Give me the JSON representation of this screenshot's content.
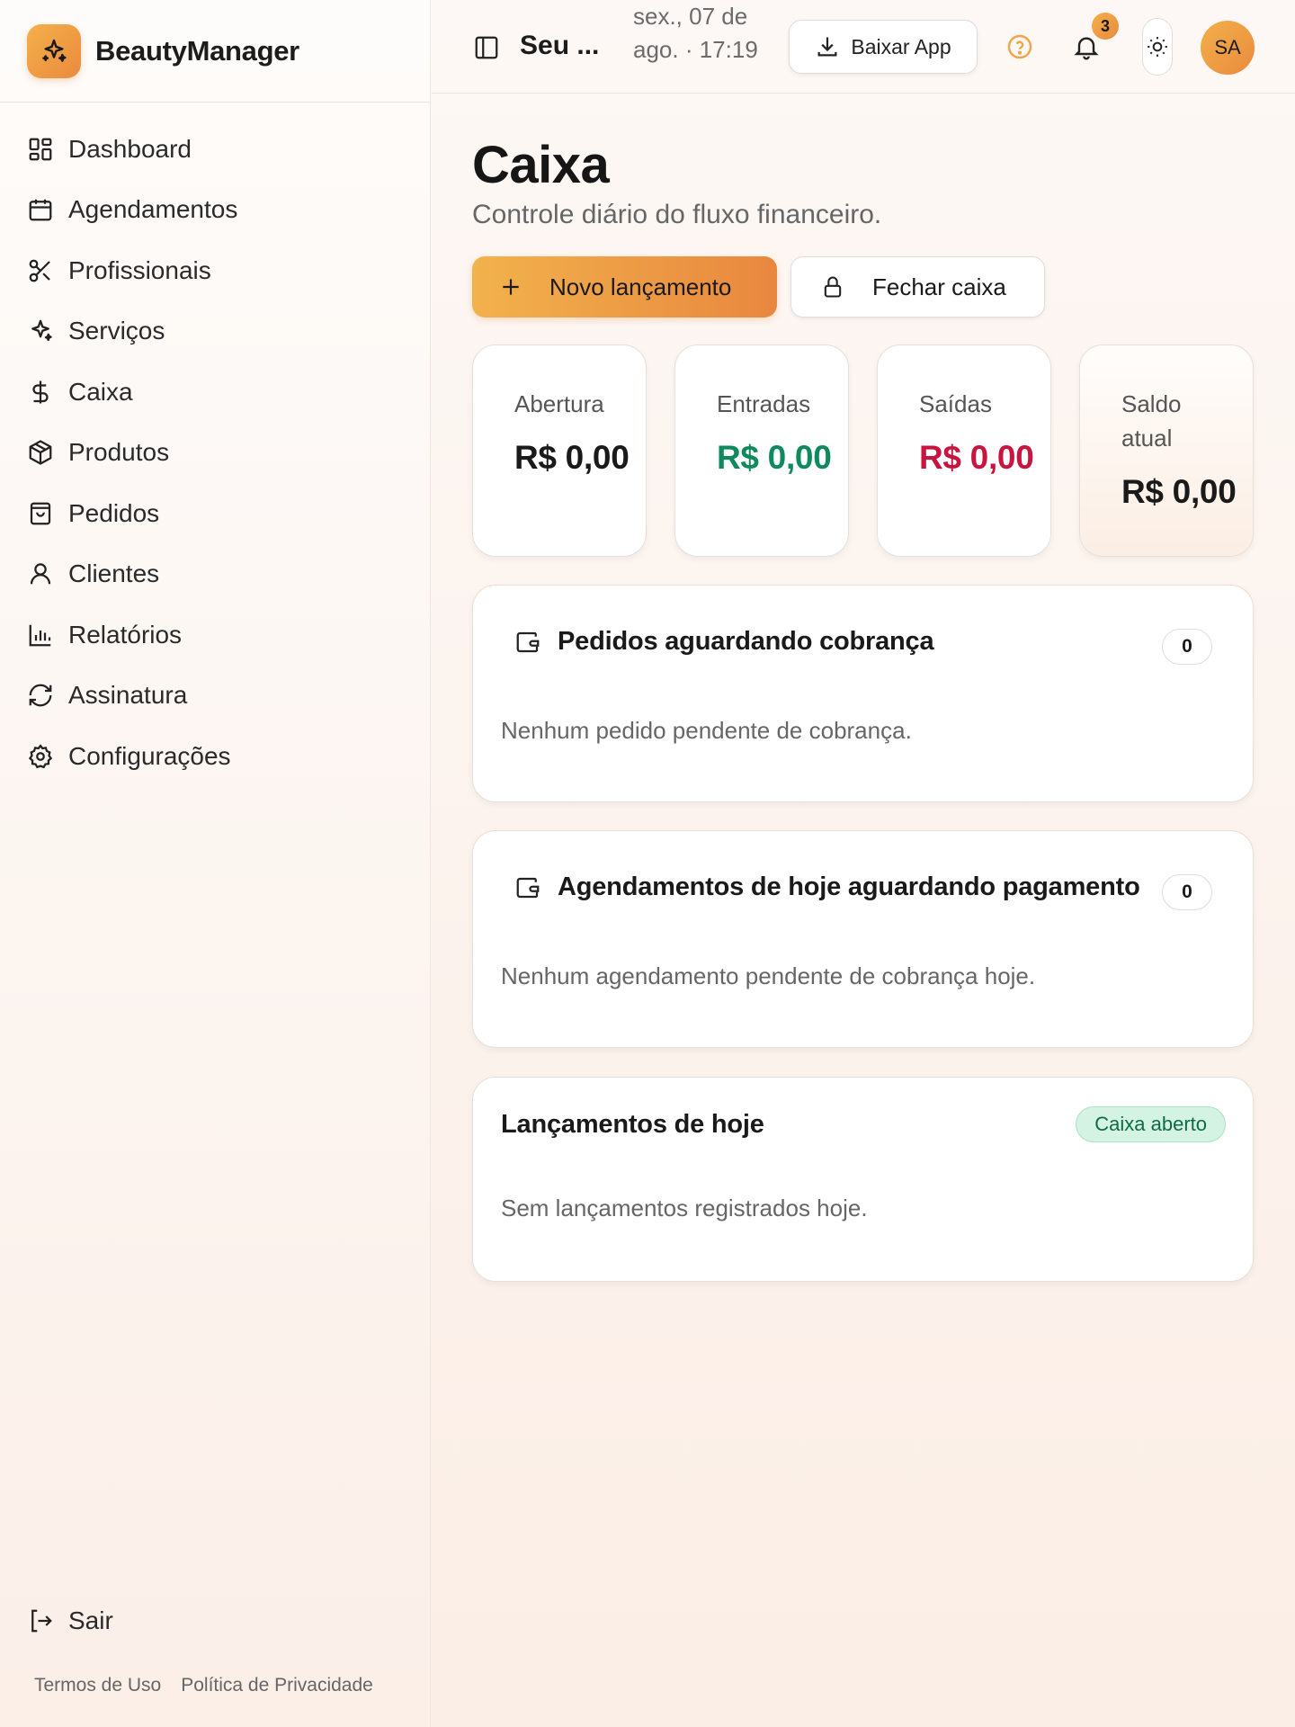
{
  "app": {
    "name": "BeautyManager"
  },
  "sidebar": {
    "items": [
      {
        "label": "Dashboard",
        "icon": "dashboard-icon"
      },
      {
        "label": "Agendamentos",
        "icon": "calendar-icon"
      },
      {
        "label": "Profissionais",
        "icon": "scissors-icon"
      },
      {
        "label": "Serviços",
        "icon": "sparkles-icon"
      },
      {
        "label": "Caixa",
        "icon": "dollar-icon"
      },
      {
        "label": "Produtos",
        "icon": "package-icon"
      },
      {
        "label": "Pedidos",
        "icon": "shopping-bag-icon"
      },
      {
        "label": "Clientes",
        "icon": "user-icon"
      },
      {
        "label": "Relatórios",
        "icon": "bar-chart-icon"
      },
      {
        "label": "Assinatura",
        "icon": "refresh-icon"
      },
      {
        "label": "Configurações",
        "icon": "gear-icon"
      }
    ],
    "logout_label": "Sair",
    "footer": {
      "terms": "Termos de Uso",
      "privacy": "Política de Privacidade"
    }
  },
  "header": {
    "salon_name": "Seu ...",
    "datetime": "sex., 07 de ago. · 17:19",
    "download_label": "Baixar App",
    "notification_count": "3",
    "avatar_initials": "SA"
  },
  "page": {
    "title": "Caixa",
    "subtitle": "Controle diário do fluxo financeiro.",
    "new_entry_label": "Novo lançamento",
    "close_register_label": "Fechar caixa"
  },
  "stats": [
    {
      "label": "Abertura",
      "value": "R$ 0,00",
      "color": "#1a1a1a"
    },
    {
      "label": "Entradas",
      "value": "R$ 0,00",
      "color": "#0e8a5c"
    },
    {
      "label": "Saídas",
      "value": "R$ 0,00",
      "color": "#c8143f"
    },
    {
      "label": "Saldo atual",
      "value": "R$ 0,00",
      "color": "#1a1a1a"
    }
  ],
  "panels": {
    "pending_orders": {
      "title": "Pedidos aguardando cobrança",
      "count": "0",
      "empty": "Nenhum pedido pendente de cobrança."
    },
    "pending_appointments": {
      "title": "Agendamentos de hoje aguardando pagamento",
      "count": "0",
      "empty": "Nenhum agendamento pendente de cobrança hoje."
    },
    "today_entries": {
      "title": "Lançamentos de hoje",
      "status": "Caixa aberto",
      "empty": "Sem lançamentos registrados hoje."
    }
  },
  "colors": {
    "accent": "#f0a447",
    "income": "#0e8a5c",
    "expense": "#c8143f",
    "status_open": "#0f6b43"
  }
}
